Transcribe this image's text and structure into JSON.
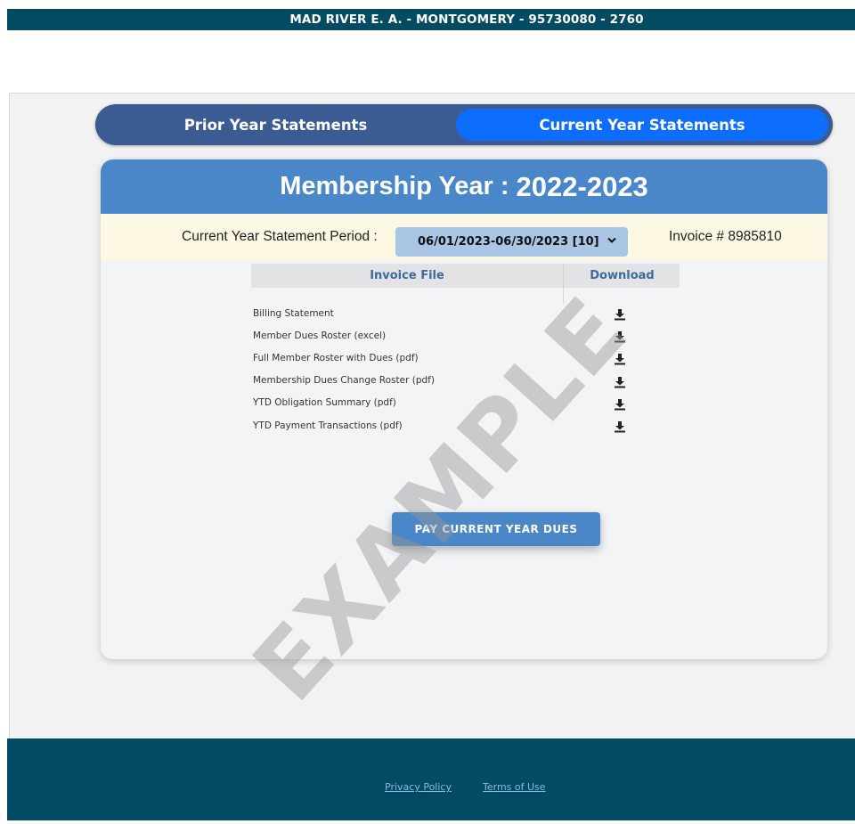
{
  "header": {
    "title": "MAD RIVER E. A. - MONTGOMERY - 95730080 - 2760"
  },
  "tabs": [
    {
      "label": "Prior Year Statements",
      "active": false
    },
    {
      "label": "Current Year Statements",
      "active": true
    }
  ],
  "card": {
    "title_prefix": "Membership Year :",
    "year": "2022-2023",
    "period_label": "Current Year Statement Period :",
    "period_selected": "06/01/2023-06/30/2023 [10]",
    "invoice_label": "Invoice # 8985810"
  },
  "table": {
    "columns": [
      "Invoice File",
      "Download"
    ],
    "rows": [
      {
        "name": "Billing Statement",
        "icon": "download-icon"
      },
      {
        "name": "Member Dues Roster (excel)",
        "icon": "download-icon"
      },
      {
        "name": "Full Member Roster with Dues (pdf)",
        "icon": "download-icon"
      },
      {
        "name": "Membership Dues Change Roster (pdf)",
        "icon": "download-icon"
      },
      {
        "name": "YTD Obligation Summary (pdf)",
        "icon": "download-icon"
      },
      {
        "name": "YTD Payment Transactions (pdf)",
        "icon": "download-icon"
      }
    ]
  },
  "pay_button": {
    "label": "PAY CURRENT YEAR DUES"
  },
  "watermark": {
    "text": "EXAMPLE"
  },
  "footer": {
    "links": [
      "Privacy Policy",
      "Terms of Use"
    ]
  },
  "colors": {
    "topbar": "#034b62",
    "tab_track": "#3b5b93",
    "tab_active": "#0d6efd",
    "card_header": "#4a87c8",
    "period_row": "#fdf8e4",
    "select_bg": "#a9c6e4",
    "column_header_text": "#3f6aa0",
    "footer": "#034b62",
    "footer_link": "#86b8de"
  }
}
